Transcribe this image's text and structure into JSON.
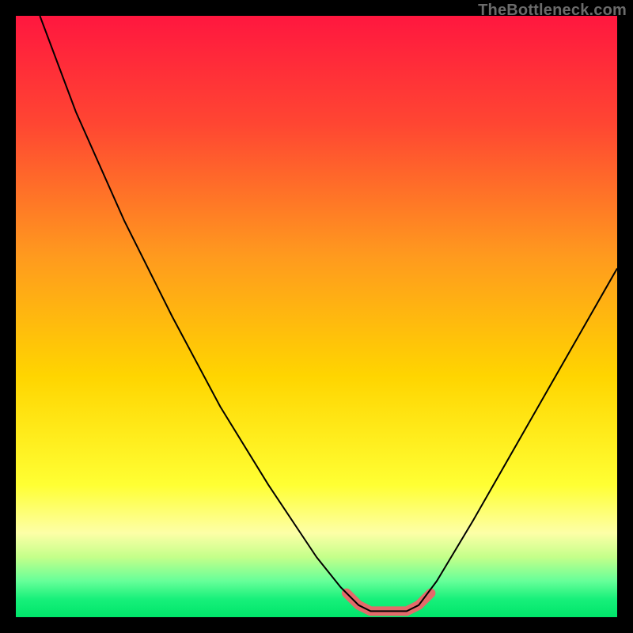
{
  "watermark": "TheBottleneck.com",
  "chart_data": {
    "type": "line",
    "title": "",
    "xlabel": "",
    "ylabel": "",
    "xlim": [
      0,
      100
    ],
    "ylim": [
      0,
      100
    ],
    "grid": false,
    "legend": false,
    "background_gradient_stops": [
      {
        "offset": 0.0,
        "color": "#ff173f"
      },
      {
        "offset": 0.18,
        "color": "#ff4632"
      },
      {
        "offset": 0.4,
        "color": "#ff9a1e"
      },
      {
        "offset": 0.6,
        "color": "#ffd500"
      },
      {
        "offset": 0.78,
        "color": "#ffff33"
      },
      {
        "offset": 0.86,
        "color": "#fdffa7"
      },
      {
        "offset": 0.9,
        "color": "#c4ff8a"
      },
      {
        "offset": 0.94,
        "color": "#66ff99"
      },
      {
        "offset": 0.97,
        "color": "#17f07a"
      },
      {
        "offset": 1.0,
        "color": "#00e56a"
      }
    ],
    "series": [
      {
        "name": "bottleneck-curve",
        "stroke": "#000000",
        "stroke_width": 2,
        "points": [
          {
            "x": 4.0,
            "y": 100.0
          },
          {
            "x": 10.0,
            "y": 84.0
          },
          {
            "x": 18.0,
            "y": 66.0
          },
          {
            "x": 26.0,
            "y": 50.0
          },
          {
            "x": 34.0,
            "y": 35.0
          },
          {
            "x": 42.0,
            "y": 22.0
          },
          {
            "x": 50.0,
            "y": 10.0
          },
          {
            "x": 54.0,
            "y": 5.0
          },
          {
            "x": 57.0,
            "y": 2.0
          },
          {
            "x": 59.0,
            "y": 1.0
          },
          {
            "x": 62.0,
            "y": 1.0
          },
          {
            "x": 65.0,
            "y": 1.0
          },
          {
            "x": 67.0,
            "y": 2.0
          },
          {
            "x": 70.0,
            "y": 6.0
          },
          {
            "x": 76.0,
            "y": 16.0
          },
          {
            "x": 84.0,
            "y": 30.0
          },
          {
            "x": 92.0,
            "y": 44.0
          },
          {
            "x": 100.0,
            "y": 58.0
          }
        ]
      },
      {
        "name": "sweet-spot-highlight",
        "stroke": "#e46a6a",
        "stroke_width": 12,
        "linecap": "round",
        "points": [
          {
            "x": 55.0,
            "y": 4.0
          },
          {
            "x": 57.0,
            "y": 2.0
          },
          {
            "x": 59.0,
            "y": 1.0
          },
          {
            "x": 62.0,
            "y": 1.0
          },
          {
            "x": 65.0,
            "y": 1.0
          },
          {
            "x": 67.0,
            "y": 2.0
          },
          {
            "x": 69.0,
            "y": 4.0
          }
        ]
      }
    ]
  }
}
